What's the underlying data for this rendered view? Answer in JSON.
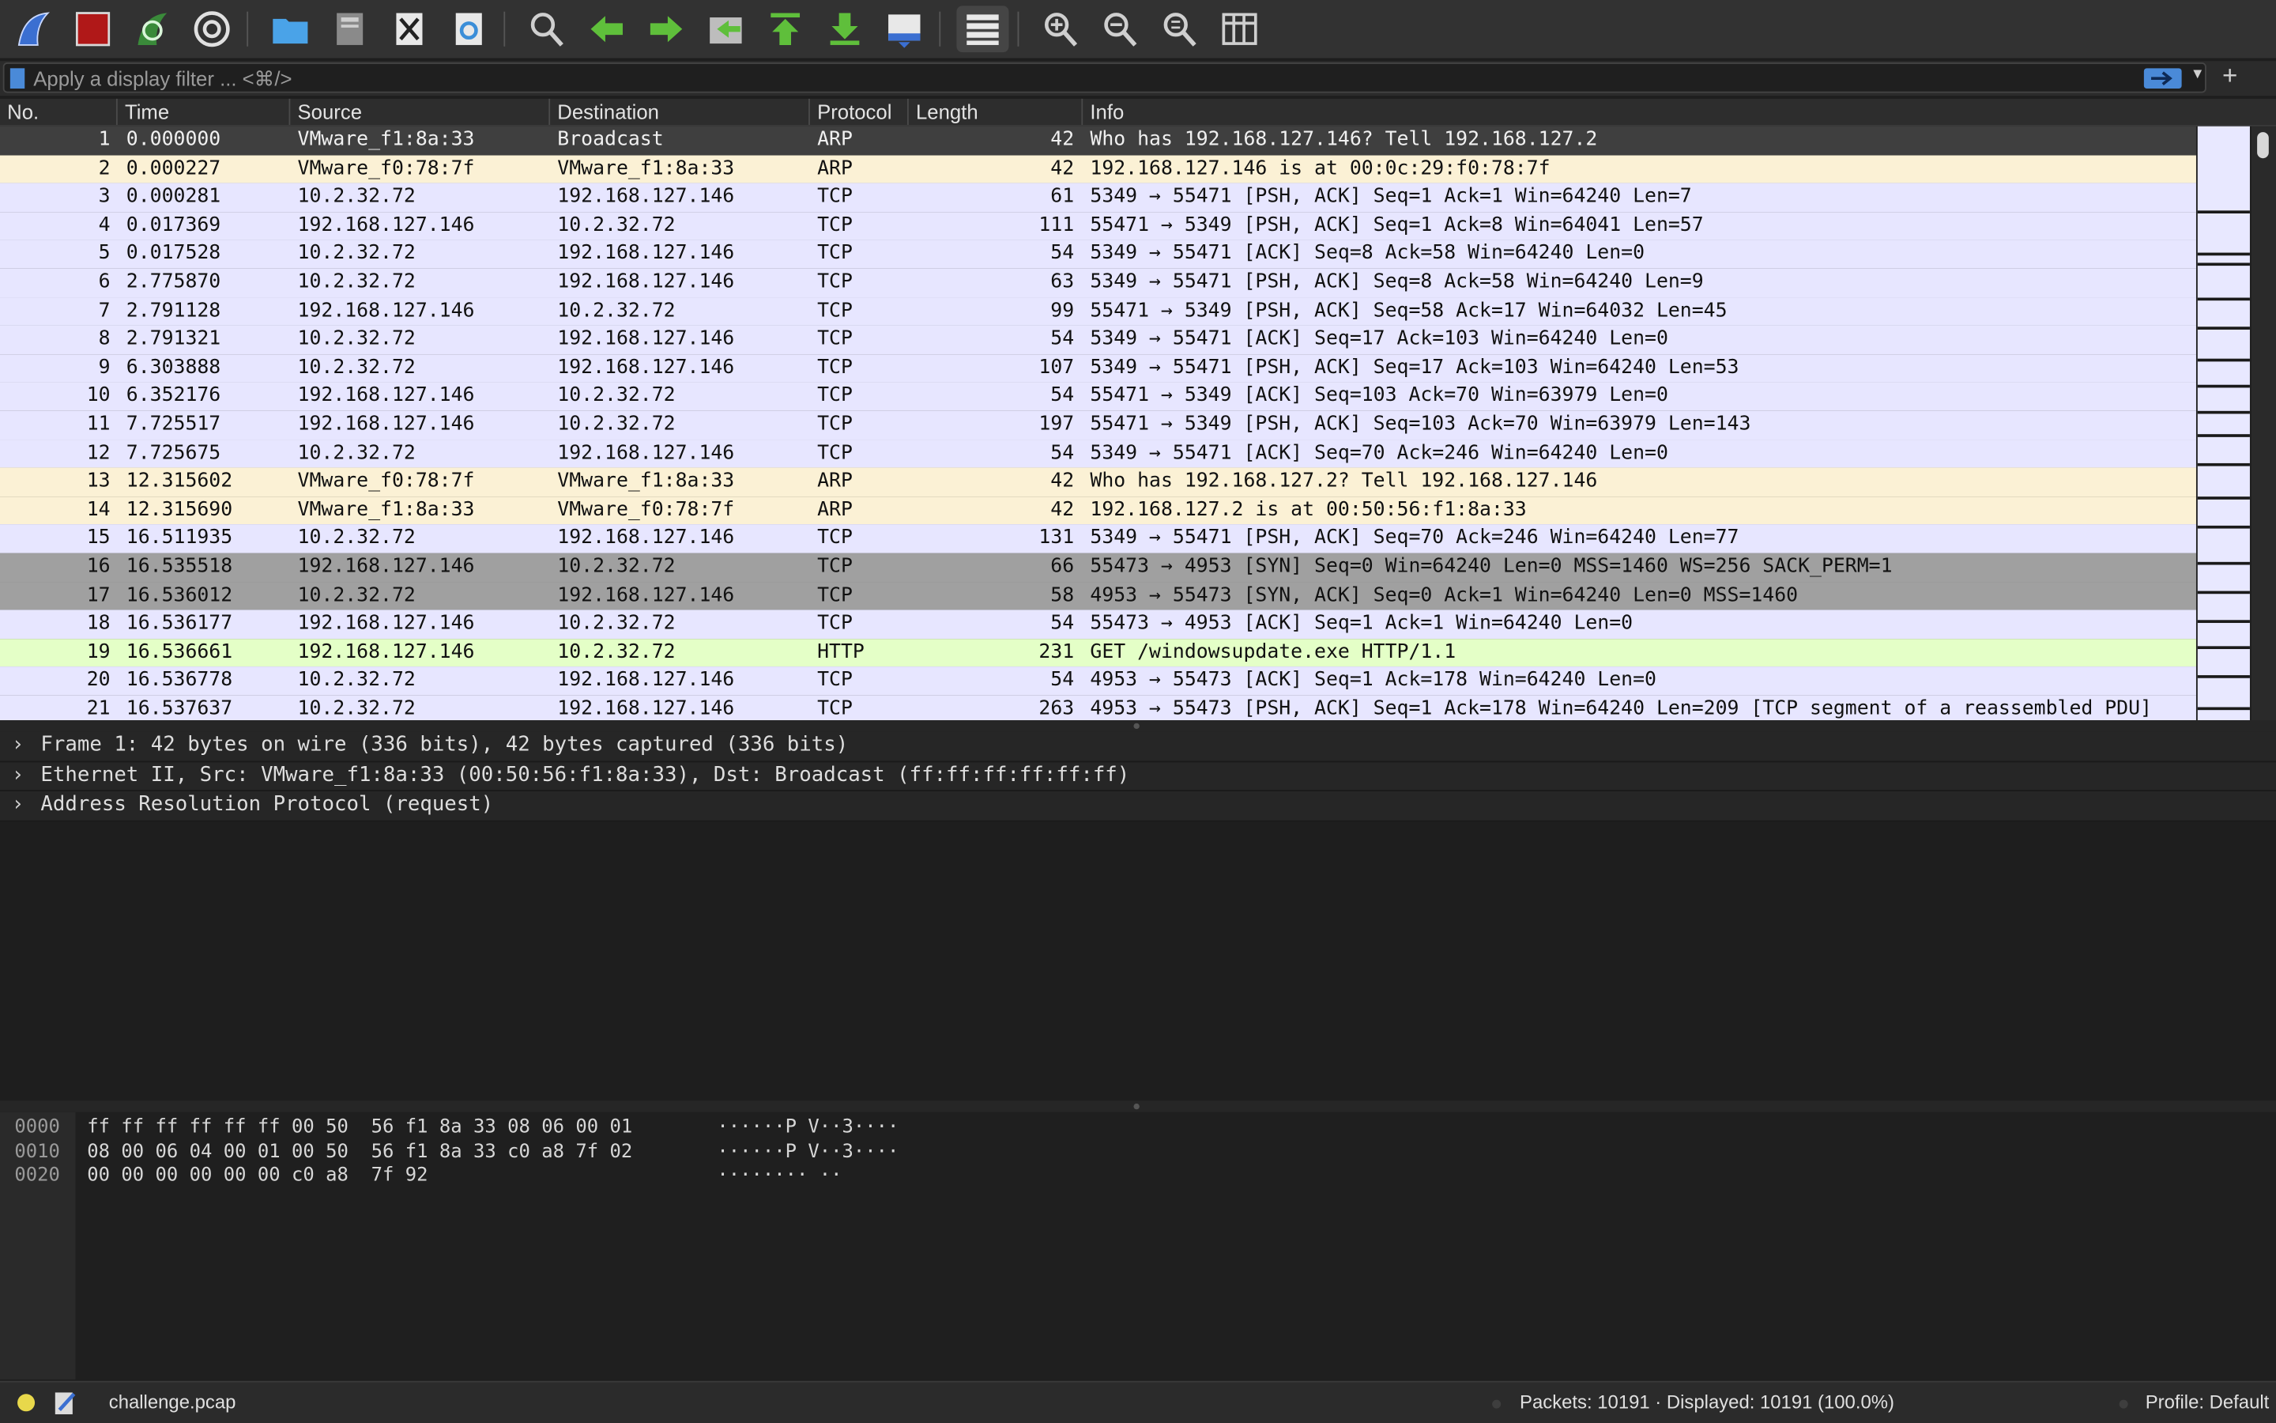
{
  "toolbar": {
    "buttons": [
      {
        "name": "start-capture-icon",
        "color": "#3b6fd1"
      },
      {
        "name": "stop-capture-icon",
        "color": "#b01818"
      },
      {
        "name": "restart-capture-icon",
        "color": "#3a8a3a"
      },
      {
        "name": "capture-options-icon",
        "color": "#d0d0d0"
      },
      {
        "name": "open-file-icon",
        "color": "#4aa3e8"
      },
      {
        "name": "save-file-icon",
        "color": "#8a8a8a"
      },
      {
        "name": "close-file-icon",
        "color": "#d0d0d0"
      },
      {
        "name": "reload-file-icon",
        "color": "#4aa3e8"
      },
      {
        "name": "find-packet-icon",
        "color": "#cfcfcf"
      },
      {
        "name": "go-back-icon",
        "color": "#5fbf3b"
      },
      {
        "name": "go-forward-icon",
        "color": "#5fbf3b"
      },
      {
        "name": "go-to-packet-icon",
        "color": "#5fbf3b"
      },
      {
        "name": "go-first-packet-icon",
        "color": "#5fbf3b"
      },
      {
        "name": "go-last-packet-icon",
        "color": "#5fbf3b"
      },
      {
        "name": "auto-scroll-icon",
        "color": "#4aa3e8"
      },
      {
        "name": "colorize-icon",
        "color": "#cfcfcf"
      },
      {
        "name": "zoom-in-icon",
        "color": "#cfcfcf"
      },
      {
        "name": "zoom-out-icon",
        "color": "#cfcfcf"
      },
      {
        "name": "zoom-reset-icon",
        "color": "#cfcfcf"
      },
      {
        "name": "resize-columns-icon",
        "color": "#cfcfcf"
      }
    ]
  },
  "filter": {
    "placeholder": "Apply a display filter ... <⌘/>",
    "value": ""
  },
  "packet_list": {
    "columns": [
      "No.",
      "Time",
      "Source",
      "Destination",
      "Protocol",
      "Length",
      "Info"
    ],
    "rows": [
      {
        "no": "1",
        "time": "0.000000",
        "src": "VMware_f1:8a:33",
        "dst": "Broadcast",
        "proto": "ARP",
        "len": "42",
        "info": "Who has 192.168.127.146? Tell 192.168.127.2",
        "style": "selected"
      },
      {
        "no": "2",
        "time": "0.000227",
        "src": "VMware_f0:78:7f",
        "dst": "VMware_f1:8a:33",
        "proto": "ARP",
        "len": "42",
        "info": "192.168.127.146 is at 00:0c:29:f0:78:7f",
        "style": "arp"
      },
      {
        "no": "3",
        "time": "0.000281",
        "src": "10.2.32.72",
        "dst": "192.168.127.146",
        "proto": "TCP",
        "len": "61",
        "info": "5349 → 55471 [PSH, ACK] Seq=1 Ack=1 Win=64240 Len=7",
        "style": "tcp"
      },
      {
        "no": "4",
        "time": "0.017369",
        "src": "192.168.127.146",
        "dst": "10.2.32.72",
        "proto": "TCP",
        "len": "111",
        "info": "55471 → 5349 [PSH, ACK] Seq=1 Ack=8 Win=64041 Len=57",
        "style": "tcp"
      },
      {
        "no": "5",
        "time": "0.017528",
        "src": "10.2.32.72",
        "dst": "192.168.127.146",
        "proto": "TCP",
        "len": "54",
        "info": "5349 → 55471 [ACK] Seq=8 Ack=58 Win=64240 Len=0",
        "style": "tcp"
      },
      {
        "no": "6",
        "time": "2.775870",
        "src": "10.2.32.72",
        "dst": "192.168.127.146",
        "proto": "TCP",
        "len": "63",
        "info": "5349 → 55471 [PSH, ACK] Seq=8 Ack=58 Win=64240 Len=9",
        "style": "tcp"
      },
      {
        "no": "7",
        "time": "2.791128",
        "src": "192.168.127.146",
        "dst": "10.2.32.72",
        "proto": "TCP",
        "len": "99",
        "info": "55471 → 5349 [PSH, ACK] Seq=58 Ack=17 Win=64032 Len=45",
        "style": "tcp"
      },
      {
        "no": "8",
        "time": "2.791321",
        "src": "10.2.32.72",
        "dst": "192.168.127.146",
        "proto": "TCP",
        "len": "54",
        "info": "5349 → 55471 [ACK] Seq=17 Ack=103 Win=64240 Len=0",
        "style": "tcp"
      },
      {
        "no": "9",
        "time": "6.303888",
        "src": "10.2.32.72",
        "dst": "192.168.127.146",
        "proto": "TCP",
        "len": "107",
        "info": "5349 → 55471 [PSH, ACK] Seq=17 Ack=103 Win=64240 Len=53",
        "style": "tcp"
      },
      {
        "no": "10",
        "time": "6.352176",
        "src": "192.168.127.146",
        "dst": "10.2.32.72",
        "proto": "TCP",
        "len": "54",
        "info": "55471 → 5349 [ACK] Seq=103 Ack=70 Win=63979 Len=0",
        "style": "tcp"
      },
      {
        "no": "11",
        "time": "7.725517",
        "src": "192.168.127.146",
        "dst": "10.2.32.72",
        "proto": "TCP",
        "len": "197",
        "info": "55471 → 5349 [PSH, ACK] Seq=103 Ack=70 Win=63979 Len=143",
        "style": "tcp"
      },
      {
        "no": "12",
        "time": "7.725675",
        "src": "10.2.32.72",
        "dst": "192.168.127.146",
        "proto": "TCP",
        "len": "54",
        "info": "5349 → 55471 [ACK] Seq=70 Ack=246 Win=64240 Len=0",
        "style": "tcp"
      },
      {
        "no": "13",
        "time": "12.315602",
        "src": "VMware_f0:78:7f",
        "dst": "VMware_f1:8a:33",
        "proto": "ARP",
        "len": "42",
        "info": "Who has 192.168.127.2? Tell 192.168.127.146",
        "style": "arp"
      },
      {
        "no": "14",
        "time": "12.315690",
        "src": "VMware_f1:8a:33",
        "dst": "VMware_f0:78:7f",
        "proto": "ARP",
        "len": "42",
        "info": "192.168.127.2 is at 00:50:56:f1:8a:33",
        "style": "arp"
      },
      {
        "no": "15",
        "time": "16.511935",
        "src": "10.2.32.72",
        "dst": "192.168.127.146",
        "proto": "TCP",
        "len": "131",
        "info": "5349 → 55471 [PSH, ACK] Seq=70 Ack=246 Win=64240 Len=77",
        "style": "tcp"
      },
      {
        "no": "16",
        "time": "16.535518",
        "src": "192.168.127.146",
        "dst": "10.2.32.72",
        "proto": "TCP",
        "len": "66",
        "info": "55473 → 4953 [SYN] Seq=0 Win=64240 Len=0 MSS=1460 WS=256 SACK_PERM=1",
        "style": "syn"
      },
      {
        "no": "17",
        "time": "16.536012",
        "src": "10.2.32.72",
        "dst": "192.168.127.146",
        "proto": "TCP",
        "len": "58",
        "info": "4953 → 55473 [SYN, ACK] Seq=0 Ack=1 Win=64240 Len=0 MSS=1460",
        "style": "syn"
      },
      {
        "no": "18",
        "time": "16.536177",
        "src": "192.168.127.146",
        "dst": "10.2.32.72",
        "proto": "TCP",
        "len": "54",
        "info": "55473 → 4953 [ACK] Seq=1 Ack=1 Win=64240 Len=0",
        "style": "tcp"
      },
      {
        "no": "19",
        "time": "16.536661",
        "src": "192.168.127.146",
        "dst": "10.2.32.72",
        "proto": "HTTP",
        "len": "231",
        "info": "GET /windowsupdate.exe HTTP/1.1",
        "style": "http"
      },
      {
        "no": "20",
        "time": "16.536778",
        "src": "10.2.32.72",
        "dst": "192.168.127.146",
        "proto": "TCP",
        "len": "54",
        "info": "4953 → 55473 [ACK] Seq=1 Ack=178 Win=64240 Len=0",
        "style": "tcp"
      },
      {
        "no": "21",
        "time": "16.537637",
        "src": "10.2.32.72",
        "dst": "192.168.127.146",
        "proto": "TCP",
        "len": "263",
        "info": "4953 → 55473 [PSH, ACK] Seq=1 Ack=178 Win=64240 Len=209 [TCP segment of a reassembled PDU]",
        "style": "tcp"
      }
    ]
  },
  "details": [
    {
      "text": "Frame 1: 42 bytes on wire (336 bits), 42 bytes captured (336 bits)"
    },
    {
      "text": "Ethernet II, Src: VMware_f1:8a:33 (00:50:56:f1:8a:33), Dst: Broadcast (ff:ff:ff:ff:ff:ff)"
    },
    {
      "text": "Address Resolution Protocol (request)"
    }
  ],
  "hex": [
    {
      "offset": "0000",
      "bytes": "ff ff ff ff ff ff 00 50  56 f1 8a 33 08 06 00 01",
      "ascii": "······P V··3····"
    },
    {
      "offset": "0010",
      "bytes": "08 00 06 04 00 01 00 50  56 f1 8a 33 c0 a8 7f 02",
      "ascii": "······P V··3····"
    },
    {
      "offset": "0020",
      "bytes": "00 00 00 00 00 00 c0 a8  7f 92",
      "ascii": "········ ··"
    }
  ],
  "status": {
    "file": "challenge.pcap",
    "packets": "Packets: 10191 · Displayed: 10191 (100.0%)",
    "profile": "Profile: Default"
  }
}
